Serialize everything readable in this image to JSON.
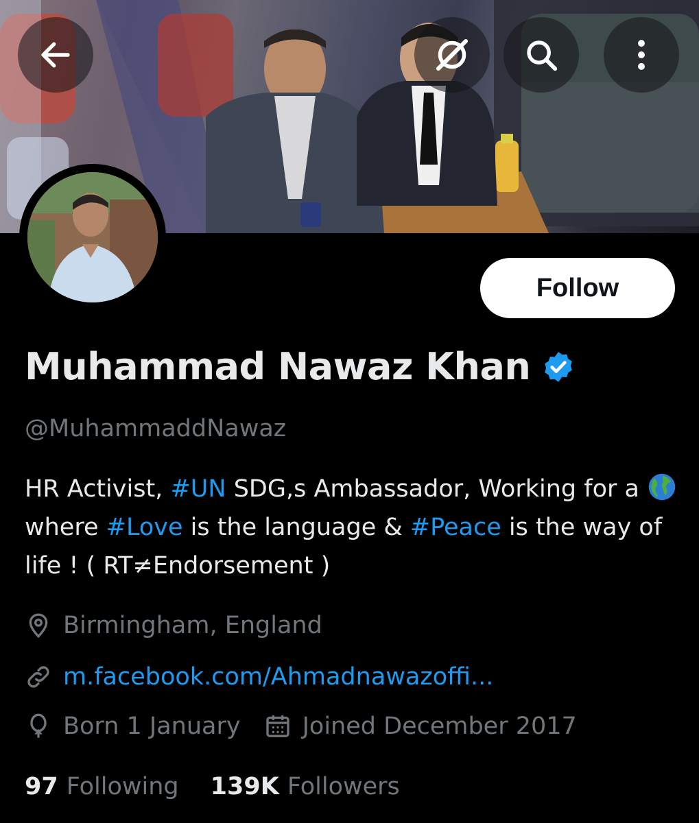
{
  "header": {
    "back_icon": "arrow-left-icon",
    "disabled_icon": "grok-slash-icon",
    "search_icon": "search-icon",
    "more_icon": "more-vertical-icon"
  },
  "profile": {
    "display_name": "Muhammad Nawaz Khan",
    "handle": "@MuhammaddNawaz",
    "verified": true,
    "follow_label": "Follow",
    "bio": {
      "p1": "HR Activist, ",
      "tag_un": "#UN",
      "p2": " SDG,s Ambassador, Working for a ",
      "emoji": "globe-emoji",
      "p3": " where ",
      "tag_love": "#Love",
      "p4": " is the language & ",
      "tag_peace": "#Peace",
      "p5": " is the way of life ! ( RT≠Endorsement )"
    },
    "location": "Birmingham, England",
    "website": "m.facebook.com/Ahmadnawazoffi...",
    "born": "Born 1 January",
    "joined": "Joined December 2017",
    "following_count": "97",
    "following_label": "Following",
    "followers_count": "139K",
    "followers_label": "Followers"
  },
  "colors": {
    "background": "#000000",
    "text_primary": "#e7e9ea",
    "text_secondary": "#71767b",
    "accent": "#1d9bf0"
  }
}
